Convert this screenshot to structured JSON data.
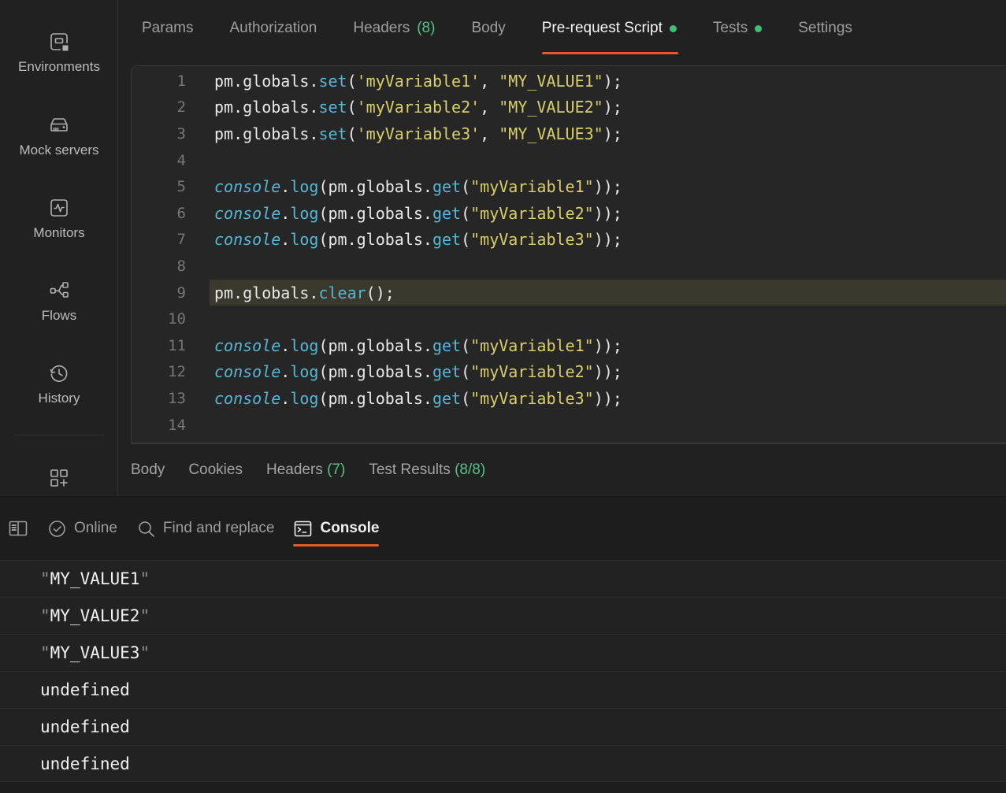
{
  "colors": {
    "accent_orange": "#e8562d",
    "green_count": "#57c08a",
    "green_dot": "#3fbf71",
    "syntax_cyan": "#55b7d4",
    "syntax_yellow": "#d9cf6a",
    "editor_highlight": "#3a392e"
  },
  "sidebar": {
    "items": [
      {
        "label": "Environments",
        "icon": "environments-icon"
      },
      {
        "label": "Mock servers",
        "icon": "mock-servers-icon"
      },
      {
        "label": "Monitors",
        "icon": "monitors-icon"
      },
      {
        "label": "Flows",
        "icon": "flows-icon"
      },
      {
        "label": "History",
        "icon": "history-icon"
      }
    ],
    "footer_icon": "grid-plus-icon"
  },
  "request_tabs": {
    "items": [
      {
        "label": "Params"
      },
      {
        "label": "Authorization"
      },
      {
        "label": "Headers",
        "count": "(8)"
      },
      {
        "label": "Body"
      },
      {
        "label": "Pre-request Script",
        "active": true,
        "dot": true
      },
      {
        "label": "Tests",
        "dot": true
      },
      {
        "label": "Settings"
      }
    ]
  },
  "editor": {
    "active_line": 9,
    "lines": [
      {
        "num": 1,
        "tokens": [
          {
            "t": "p",
            "v": "pm.globals."
          },
          {
            "t": "fn",
            "v": "set"
          },
          {
            "t": "p",
            "v": "("
          },
          {
            "t": "str",
            "v": "'myVariable1'"
          },
          {
            "t": "p",
            "v": ", "
          },
          {
            "t": "str",
            "v": "\"MY_VALUE1\""
          },
          {
            "t": "p",
            "v": ");"
          }
        ]
      },
      {
        "num": 2,
        "tokens": [
          {
            "t": "p",
            "v": "pm.globals."
          },
          {
            "t": "fn",
            "v": "set"
          },
          {
            "t": "p",
            "v": "("
          },
          {
            "t": "str",
            "v": "'myVariable2'"
          },
          {
            "t": "p",
            "v": ", "
          },
          {
            "t": "str",
            "v": "\"MY_VALUE2\""
          },
          {
            "t": "p",
            "v": ");"
          }
        ]
      },
      {
        "num": 3,
        "tokens": [
          {
            "t": "p",
            "v": "pm.globals."
          },
          {
            "t": "fn",
            "v": "set"
          },
          {
            "t": "p",
            "v": "("
          },
          {
            "t": "str",
            "v": "'myVariable3'"
          },
          {
            "t": "p",
            "v": ", "
          },
          {
            "t": "str",
            "v": "\"MY_VALUE3\""
          },
          {
            "t": "p",
            "v": ");"
          }
        ]
      },
      {
        "num": 4,
        "tokens": []
      },
      {
        "num": 5,
        "tokens": [
          {
            "t": "kw",
            "v": "console"
          },
          {
            "t": "p",
            "v": "."
          },
          {
            "t": "fn",
            "v": "log"
          },
          {
            "t": "p",
            "v": "(pm.globals."
          },
          {
            "t": "fn",
            "v": "get"
          },
          {
            "t": "p",
            "v": "("
          },
          {
            "t": "str",
            "v": "\"myVariable1\""
          },
          {
            "t": "p",
            "v": "));"
          }
        ]
      },
      {
        "num": 6,
        "tokens": [
          {
            "t": "kw",
            "v": "console"
          },
          {
            "t": "p",
            "v": "."
          },
          {
            "t": "fn",
            "v": "log"
          },
          {
            "t": "p",
            "v": "(pm.globals."
          },
          {
            "t": "fn",
            "v": "get"
          },
          {
            "t": "p",
            "v": "("
          },
          {
            "t": "str",
            "v": "\"myVariable2\""
          },
          {
            "t": "p",
            "v": "));"
          }
        ]
      },
      {
        "num": 7,
        "tokens": [
          {
            "t": "kw",
            "v": "console"
          },
          {
            "t": "p",
            "v": "."
          },
          {
            "t": "fn",
            "v": "log"
          },
          {
            "t": "p",
            "v": "(pm.globals."
          },
          {
            "t": "fn",
            "v": "get"
          },
          {
            "t": "p",
            "v": "("
          },
          {
            "t": "str",
            "v": "\"myVariable3\""
          },
          {
            "t": "p",
            "v": "));"
          }
        ]
      },
      {
        "num": 8,
        "tokens": []
      },
      {
        "num": 9,
        "tokens": [
          {
            "t": "p",
            "v": "pm.globals."
          },
          {
            "t": "fn",
            "v": "clear"
          },
          {
            "t": "p",
            "v": "();"
          }
        ]
      },
      {
        "num": 10,
        "tokens": []
      },
      {
        "num": 11,
        "tokens": [
          {
            "t": "kw",
            "v": "console"
          },
          {
            "t": "p",
            "v": "."
          },
          {
            "t": "fn",
            "v": "log"
          },
          {
            "t": "p",
            "v": "(pm.globals."
          },
          {
            "t": "fn",
            "v": "get"
          },
          {
            "t": "p",
            "v": "("
          },
          {
            "t": "str",
            "v": "\"myVariable1\""
          },
          {
            "t": "p",
            "v": "));"
          }
        ]
      },
      {
        "num": 12,
        "tokens": [
          {
            "t": "kw",
            "v": "console"
          },
          {
            "t": "p",
            "v": "."
          },
          {
            "t": "fn",
            "v": "log"
          },
          {
            "t": "p",
            "v": "(pm.globals."
          },
          {
            "t": "fn",
            "v": "get"
          },
          {
            "t": "p",
            "v": "("
          },
          {
            "t": "str",
            "v": "\"myVariable2\""
          },
          {
            "t": "p",
            "v": "));"
          }
        ]
      },
      {
        "num": 13,
        "tokens": [
          {
            "t": "kw",
            "v": "console"
          },
          {
            "t": "p",
            "v": "."
          },
          {
            "t": "fn",
            "v": "log"
          },
          {
            "t": "p",
            "v": "(pm.globals."
          },
          {
            "t": "fn",
            "v": "get"
          },
          {
            "t": "p",
            "v": "("
          },
          {
            "t": "str",
            "v": "\"myVariable3\""
          },
          {
            "t": "p",
            "v": "));"
          }
        ]
      },
      {
        "num": 14,
        "tokens": []
      }
    ]
  },
  "response_tabs": {
    "items": [
      {
        "label": "Body"
      },
      {
        "label": "Cookies"
      },
      {
        "label": "Headers",
        "count": "(7)"
      },
      {
        "label": "Test Results",
        "count": "(8/8)"
      }
    ]
  },
  "console_bar": {
    "online_label": "Online",
    "find_label": "Find and replace",
    "console_label": "Console"
  },
  "console_rows": [
    {
      "prefix": "\"",
      "value": "MY_VALUE1",
      "suffix": "\""
    },
    {
      "prefix": "\"",
      "value": "MY_VALUE2",
      "suffix": "\""
    },
    {
      "prefix": "\"",
      "value": "MY_VALUE3",
      "suffix": "\""
    },
    {
      "prefix": "",
      "value": "undefined",
      "suffix": ""
    },
    {
      "prefix": "",
      "value": "undefined",
      "suffix": ""
    },
    {
      "prefix": "",
      "value": "undefined",
      "suffix": ""
    }
  ]
}
